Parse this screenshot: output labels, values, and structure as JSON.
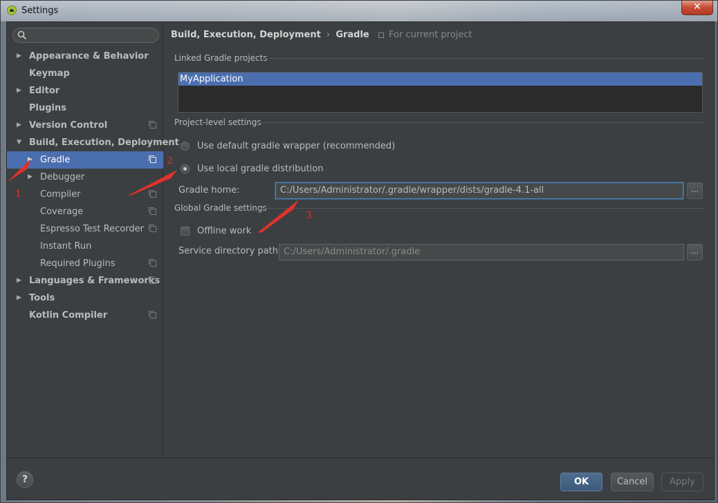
{
  "window": {
    "title": "Settings",
    "close_label": "✕"
  },
  "sidebar": {
    "search_placeholder": "",
    "items": [
      {
        "label": "Appearance & Behavior",
        "arrow": "▶",
        "level": 0,
        "bold": true,
        "copy": false
      },
      {
        "label": "Keymap",
        "arrow": "",
        "level": 0,
        "bold": true,
        "copy": false
      },
      {
        "label": "Editor",
        "arrow": "▶",
        "level": 0,
        "bold": true,
        "copy": false
      },
      {
        "label": "Plugins",
        "arrow": "",
        "level": 0,
        "bold": true,
        "copy": false
      },
      {
        "label": "Version Control",
        "arrow": "▶",
        "level": 0,
        "bold": true,
        "copy": true
      },
      {
        "label": "Build, Execution, Deployment",
        "arrow": "▼",
        "level": 0,
        "bold": true,
        "copy": false
      },
      {
        "label": "Gradle",
        "arrow": "▶",
        "level": 1,
        "bold": false,
        "copy": true,
        "selected": true
      },
      {
        "label": "Debugger",
        "arrow": "▶",
        "level": 1,
        "bold": false,
        "copy": false
      },
      {
        "label": "Compiler",
        "arrow": "",
        "level": 1,
        "bold": false,
        "copy": true
      },
      {
        "label": "Coverage",
        "arrow": "",
        "level": 1,
        "bold": false,
        "copy": true
      },
      {
        "label": "Espresso Test Recorder",
        "arrow": "",
        "level": 1,
        "bold": false,
        "copy": true
      },
      {
        "label": "Instant Run",
        "arrow": "",
        "level": 1,
        "bold": false,
        "copy": false
      },
      {
        "label": "Required Plugins",
        "arrow": "",
        "level": 1,
        "bold": false,
        "copy": true
      },
      {
        "label": "Languages & Frameworks",
        "arrow": "▶",
        "level": 0,
        "bold": true,
        "copy": true
      },
      {
        "label": "Tools",
        "arrow": "▶",
        "level": 0,
        "bold": true,
        "copy": false
      },
      {
        "label": "Kotlin Compiler",
        "arrow": "",
        "level": 0,
        "bold": true,
        "copy": true
      }
    ]
  },
  "breadcrumb": {
    "parent": "Build, Execution, Deployment",
    "separator": "›",
    "current": "Gradle",
    "scope": "For current project"
  },
  "linked": {
    "title": "Linked Gradle projects",
    "projects": [
      "MyApplication"
    ]
  },
  "project_settings": {
    "title": "Project-level settings",
    "option_default": "Use default gradle wrapper (recommended)",
    "option_local": "Use local gradle distribution",
    "selected": "local",
    "gradle_home_label": "Gradle home:",
    "gradle_home_value": "C:/Users/Administrator/.gradle/wrapper/dists/gradle-4.1-all",
    "browse_label": "..."
  },
  "global_settings": {
    "title": "Global Gradle settings",
    "offline_label": "Offline work",
    "offline_checked": false,
    "service_dir_label": "Service directory path:",
    "service_dir_value": "C:/Users/Administrator/.gradle",
    "browse_label": "..."
  },
  "buttons": {
    "help": "?",
    "ok": "OK",
    "cancel": "Cancel",
    "apply": "Apply"
  },
  "annotations": {
    "one": "1",
    "two": "2",
    "three": "3",
    "color": "#e0322b"
  },
  "colors": {
    "selection": "#4b6eaf",
    "background": "#3c3f41",
    "text": "#bbbbbb"
  }
}
